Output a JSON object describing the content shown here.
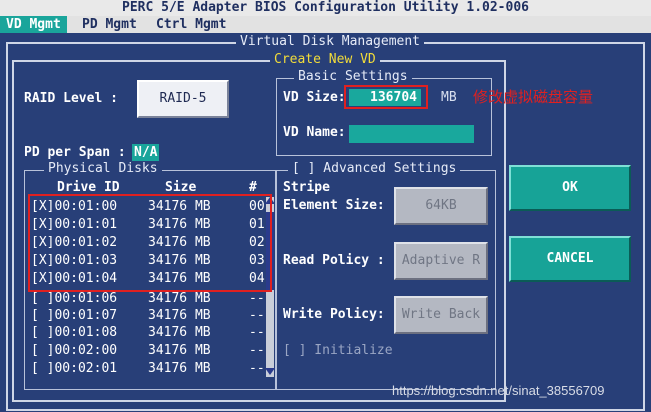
{
  "window": {
    "title": "PERC 5/E Adapter BIOS Configuration Utility 1.02-006"
  },
  "menu": {
    "tabs": [
      {
        "label": "VD Mgmt",
        "active": true
      },
      {
        "label": "PD Mgmt",
        "active": false
      },
      {
        "label": "Ctrl Mgmt",
        "active": false
      }
    ]
  },
  "vdm": {
    "title": "Virtual Disk Management"
  },
  "create": {
    "title": "Create New VD",
    "raid_label": "RAID Level :",
    "raid_value": "RAID-5",
    "pd_span_label": "PD per Span :",
    "pd_span_value": "N/A"
  },
  "physical": {
    "title": "Physical Disks",
    "col_drive": "Drive ID",
    "col_size": "Size",
    "col_num": "#",
    "rows": [
      {
        "check": "[X]",
        "id": "00:01:00",
        "size": "34176 MB",
        "num": "00"
      },
      {
        "check": "[X]",
        "id": "00:01:01",
        "size": "34176 MB",
        "num": "01"
      },
      {
        "check": "[X]",
        "id": "00:01:02",
        "size": "34176 MB",
        "num": "02"
      },
      {
        "check": "[X]",
        "id": "00:01:03",
        "size": "34176 MB",
        "num": "03"
      },
      {
        "check": "[X]",
        "id": "00:01:04",
        "size": "34176 MB",
        "num": "04"
      },
      {
        "check": "[ ]",
        "id": "00:01:06",
        "size": "34176 MB",
        "num": "--"
      },
      {
        "check": "[ ]",
        "id": "00:01:07",
        "size": "34176 MB",
        "num": "--"
      },
      {
        "check": "[ ]",
        "id": "00:01:08",
        "size": "34176 MB",
        "num": "--"
      },
      {
        "check": "[ ]",
        "id": "00:02:00",
        "size": "34176 MB",
        "num": "--"
      },
      {
        "check": "[ ]",
        "id": "00:02:01",
        "size": "34176 MB",
        "num": "--"
      }
    ]
  },
  "basic": {
    "title": "Basic Settings",
    "vd_size_label": "VD Size:",
    "vd_size_value": "136704",
    "vd_size_unit": "MB",
    "vd_name_label": "VD Name:",
    "vd_name_value": ""
  },
  "advanced": {
    "title": "[ ] Advanced Settings",
    "stripe_label1": "Stripe",
    "stripe_label2": "Element Size:",
    "stripe_value": "64KB",
    "read_label": "Read Policy :",
    "read_value": "Adaptive R",
    "write_label": "Write Policy:",
    "write_value": "Write Back",
    "init_label": "[ ] Initialize"
  },
  "buttons": {
    "ok": "OK",
    "cancel": "CANCEL"
  },
  "annotation": {
    "text": "修改虚拟磁盘容量"
  },
  "watermark": "https://blog.csdn.net/sinat_38556709",
  "colors": {
    "background": "#283f78",
    "accent_teal": "#1aa59b",
    "annotation_red": "#e02020",
    "frame_title_yellow": "#f2dc3a"
  }
}
